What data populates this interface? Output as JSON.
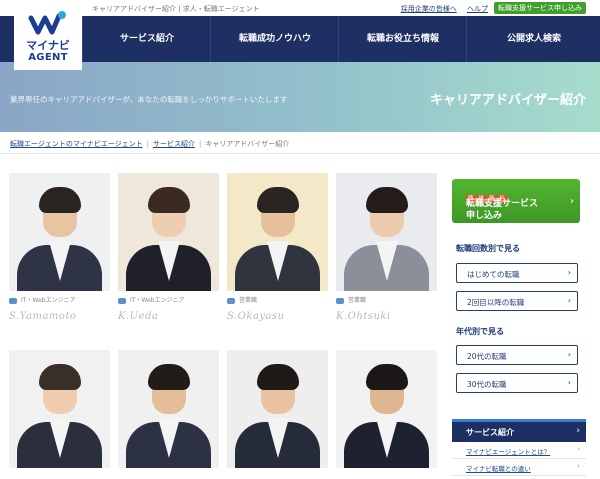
{
  "topbar": {
    "tagline": "キャリアアドバイザー紹介 | 求人・転職エージェント",
    "links": [
      "採用企業の皆様へ",
      "ヘルプ"
    ],
    "apply_button": "転職支援サービス申し込み"
  },
  "logo": {
    "brand_ja": "マイナビ",
    "brand_en": "AGENT"
  },
  "nav": {
    "items": [
      "サービス紹介",
      "転職成功ノウハウ",
      "転職お役立ち情報",
      "公開求人検索"
    ]
  },
  "hero": {
    "subtitle": "業界専任のキャリアアドバイザーが、あなたの転職をしっかりサポートいたします",
    "title": "キャリアアドバイザー紹介"
  },
  "breadcrumb": {
    "items": [
      "転職エージェントのマイナビエージェント",
      "サービス紹介",
      "キャリアアドバイザー紹介"
    ]
  },
  "advisors": [
    {
      "meta": "IT・Webエンジニア",
      "signature": "S.Yamamoto",
      "hair": "#2b2521",
      "suit": "#2e3346",
      "skin": "#e8c4a3",
      "bg": "#eef0f2"
    },
    {
      "meta": "IT・Webエンジニア",
      "signature": "K.Ueda",
      "hair": "#3b2a22",
      "suit": "#1f2029",
      "skin": "#efcdb0",
      "bg": "#efe7dc"
    },
    {
      "meta": "営業職",
      "signature": "S.Okayasu",
      "hair": "#2a2522",
      "suit": "#30343f",
      "skin": "#e6bf9b",
      "bg": "#f3e9c9"
    },
    {
      "meta": "営業職",
      "signature": "K.Ohtsuki",
      "hair": "#231c1a",
      "suit": "#8a8f9a",
      "skin": "#eccaae",
      "bg": "#e9ebee"
    },
    {
      "meta": "",
      "signature": "",
      "hair": "#3a2f28",
      "suit": "#2b2f3d",
      "skin": "#efcbb0",
      "bg": "#f1f1f1"
    },
    {
      "meta": "",
      "signature": "",
      "hair": "#221c19",
      "suit": "#2c3244",
      "skin": "#e4bd99",
      "bg": "#f0f0f0"
    },
    {
      "meta": "",
      "signature": "",
      "hair": "#1f1a18",
      "suit": "#262b3a",
      "skin": "#e8c2a1",
      "bg": "#eeeeee"
    },
    {
      "meta": "",
      "signature": "",
      "hair": "#1b1716",
      "suit": "#1e2230",
      "skin": "#dfb692",
      "bg": "#f2f2f2"
    }
  ],
  "sidebar": {
    "apply": {
      "chips": [
        "簡",
        "単",
        "無",
        "料"
      ],
      "line1": "転職支援サービス",
      "line2": "申し込み"
    },
    "by_count_title": "転職回数別で見る",
    "by_count": [
      "はじめての転職",
      "2回目以降の転職"
    ],
    "by_age_title": "年代別で見る",
    "by_age": [
      "20代の転職",
      "30代の転職"
    ],
    "service_title": "サービス紹介",
    "service_links": [
      "マイナビエージェントとは？",
      "マイナビ転職との違い"
    ]
  },
  "colors": {
    "nav": "#1d2f63",
    "accent_green": "#3e9f2c",
    "link": "#1f4a8c"
  }
}
